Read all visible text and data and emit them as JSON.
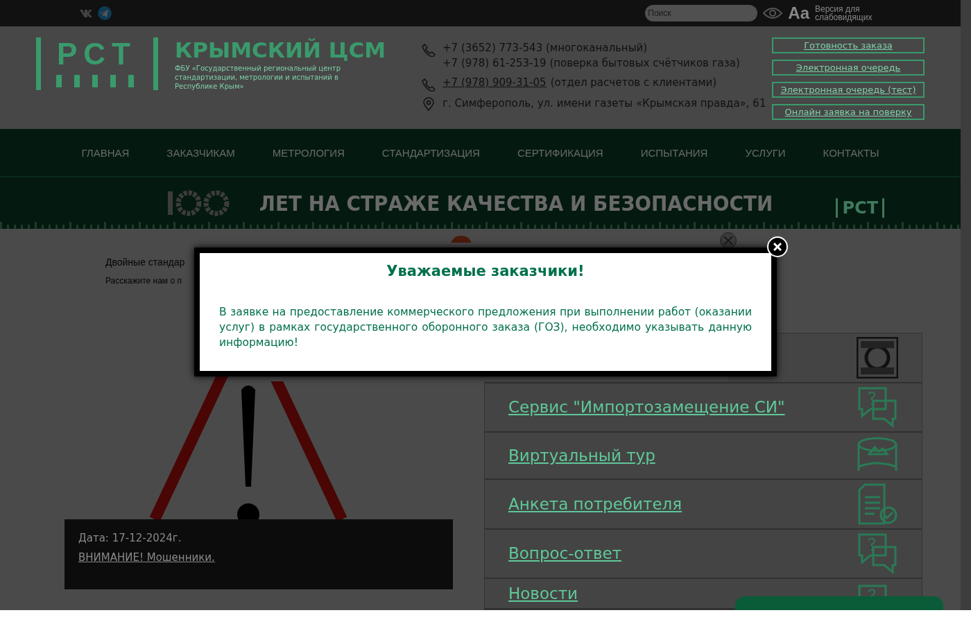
{
  "top_bar": {
    "search": {
      "placeholder": "Поиск"
    },
    "font_toggle": "Aa",
    "accessibility": "Версия для слабовидящих"
  },
  "header": {
    "logo": "РСТ",
    "title": "КРЫМСКИЙ ЦСМ",
    "subtitle": "ФБУ «Государственный региональный центр стандартизации, метрологии и испытаний в Республике Крым»",
    "contacts": [
      {
        "kind": "phone",
        "lines": [
          [
            {
              "text": "+7 (3652) 773-543 (многоканальный)",
              "link": false
            }
          ],
          [
            {
              "text": "+7 (978) 61-253-19 (поверка бытовых счётчиков газа)",
              "link": false
            }
          ]
        ]
      },
      {
        "kind": "phone",
        "lines": [
          [
            {
              "text": "+7 (978) 909-31-05",
              "link": true
            },
            {
              "text": "(отдел расчетов с клиентами)",
              "link": false
            }
          ]
        ]
      },
      {
        "kind": "address",
        "lines": [
          [
            {
              "text": "г. Симферополь, ул. имени газеты «Крымская правда», 61",
              "link": false
            }
          ]
        ]
      }
    ],
    "buttons": [
      "Готовность заказа",
      "Электронная очередь",
      "Электронная очередь (тест)",
      "Онлайн заявка на поверку"
    ]
  },
  "nav": [
    "ГЛАВНАЯ",
    "ЗАКАЗЧИКАМ",
    "МЕТРОЛОГИЯ",
    "СТАНДАРТИЗАЦИЯ",
    "СЕРТИФИКАЦИЯ",
    "ИСПЫТАНИЯ",
    "УСЛУГИ",
    "КОНТАКТЫ"
  ],
  "banner": {
    "text": "ЛЕТ НА СТРАЖЕ КАЧЕСТВА И БЕЗОПАСНОСТИ",
    "logo": "РСТ"
  },
  "article": {
    "headline": "Двойные стандар",
    "teaser": "Расскажите нам о п"
  },
  "news": {
    "date": "Дата: 17-12-2024г.",
    "title": "ВНИМАНИЕ! Мошенники."
  },
  "services": [
    {
      "kind": "badge"
    },
    {
      "label": "Сервис \"Импортозамещение СИ\"",
      "kind": "chat"
    },
    {
      "label": "Виртуальный тур",
      "kind": "panorama"
    },
    {
      "label": "Анкета потребителя",
      "kind": "form"
    },
    {
      "label": "Вопрос-ответ",
      "kind": "chat"
    },
    {
      "label": "Новости",
      "kind": "chat"
    }
  ],
  "modal": {
    "title": "Уважаемые заказчики!",
    "body": "В заявке на предоставление коммерческого предложения при выполнении работ (оказании услуг) в рамках государственного оборонного заказа (ГОЗ), необходимо указывать данную информацию!"
  }
}
